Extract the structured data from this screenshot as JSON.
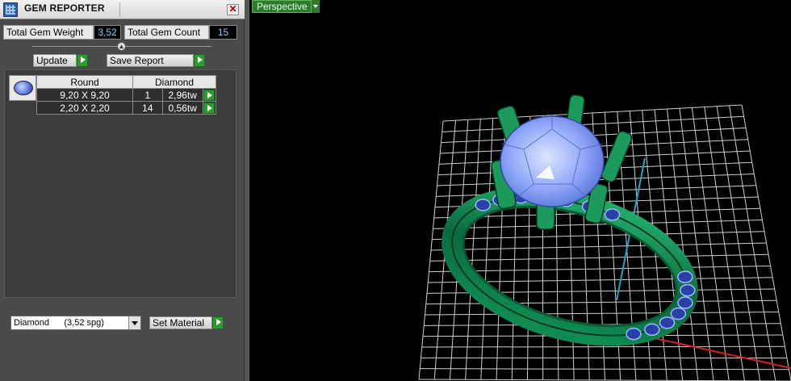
{
  "window": {
    "title": "GEM REPORTER",
    "close_glyph": "✕"
  },
  "summary": {
    "weight_label": "Total Gem Weight",
    "weight_value": "3,52",
    "count_label": "Total Gem Count",
    "count_value": "15"
  },
  "buttons": {
    "update": "Update",
    "save_report": "Save Report",
    "set_material": "Set Material"
  },
  "table": {
    "headers": [
      "Round",
      "Diamond"
    ],
    "rows": [
      {
        "size": "9,20 X 9,20",
        "count": "1",
        "weight": "2,96tw"
      },
      {
        "size": "2,20 X 2,20",
        "count": "14",
        "weight": "0,56tw"
      }
    ]
  },
  "material": {
    "selected": "Diamond      (3,52 spg)"
  },
  "viewport": {
    "view_name": "Perspective"
  },
  "colors": {
    "accent_green": "#2f9a2f",
    "value_text": "#7fd3ff",
    "ring_metal": "#0f7a4a",
    "gem_blue": "#8fb0ff",
    "grid": "#d0d0d0",
    "axis_x": "#cc2222",
    "axis_y": "#22aacc"
  },
  "icons": [
    "gem-reporter-app-icon",
    "close-icon",
    "play-arrow-icon",
    "dropdown-arrow-icon",
    "round-gem-icon"
  ]
}
